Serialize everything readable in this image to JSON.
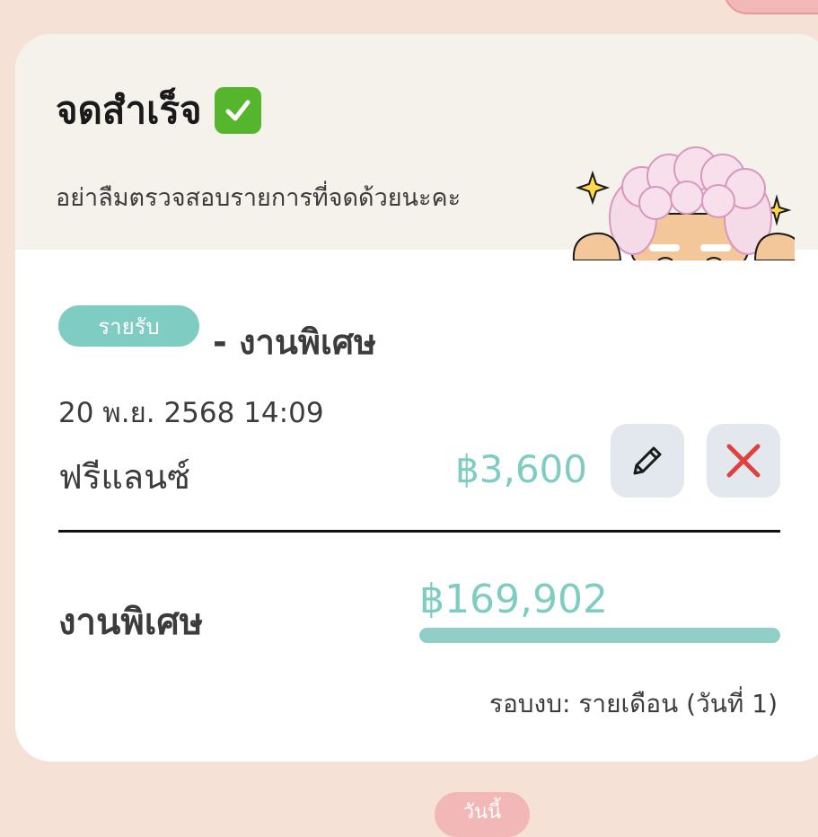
{
  "dialog": {
    "title": "จดสำเร็จ",
    "title_icon": "check-mark-button-icon",
    "subtitle": "อย่าลืมตรวจสอบรายการที่จดด้วยนะคะ",
    "mascot": "peeking-grandma-mascot"
  },
  "entry": {
    "type_tag": "รายรับ",
    "category": "- งานพิเศษ",
    "datetime": "20 พ.ย. 2568 14:09",
    "name": "ฟรีแลนซ์",
    "amount": "฿3,600",
    "edit_icon": "pencil-icon",
    "delete_icon": "close-icon"
  },
  "budget": {
    "name": "งานพิเศษ",
    "amount": "฿169,902",
    "progress_percent": 100,
    "cycle": "รอบงบ: รายเดือน (วันที่ 1)"
  },
  "footer": {
    "date_pill": "วันนี้"
  },
  "colors": {
    "background": "#f6e1d6",
    "accent": "#7fcdc2",
    "delete": "#e0413f",
    "header": "#f5f1eb",
    "pill": "#f2b8b8"
  }
}
